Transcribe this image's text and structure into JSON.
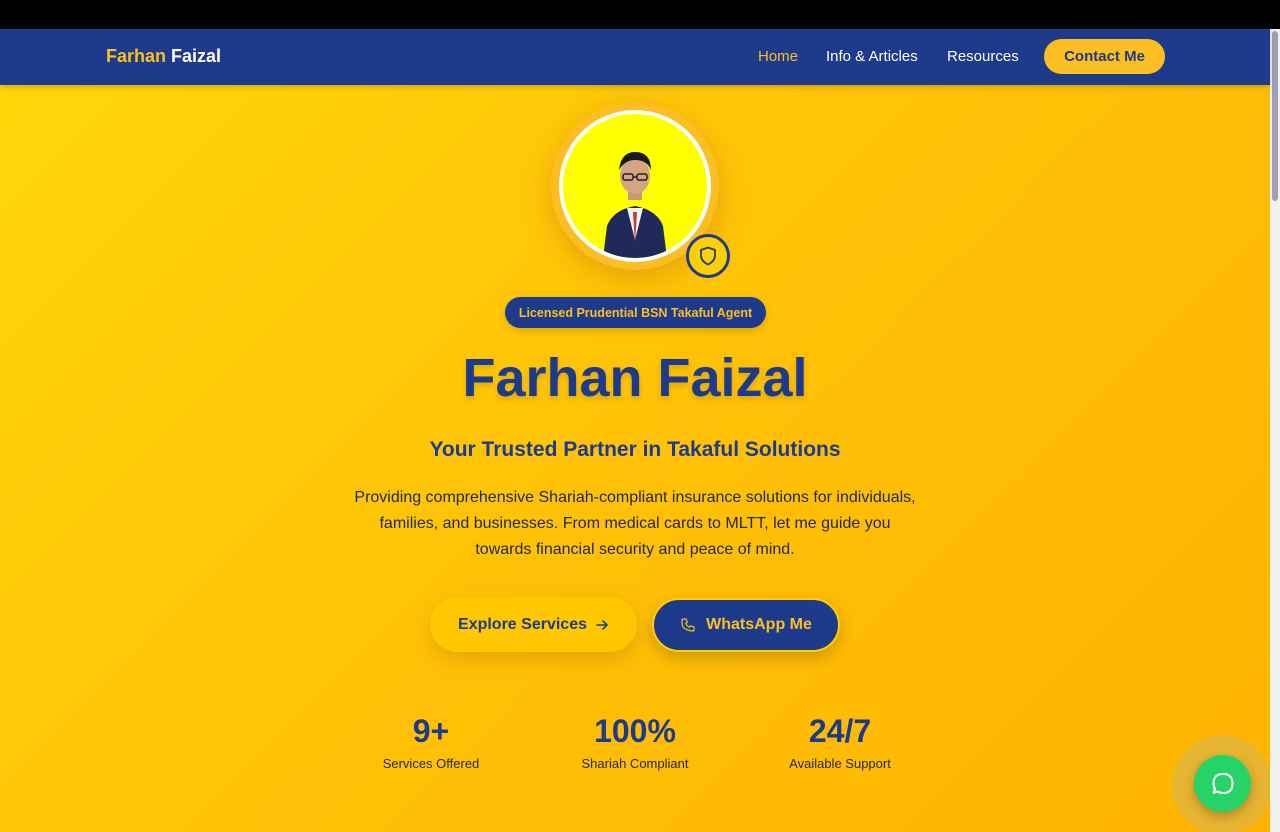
{
  "nav": {
    "brand_first": "Farhan",
    "brand_last": "Faizal",
    "links": [
      {
        "label": "Home",
        "active": true
      },
      {
        "label": "Info & Articles",
        "active": false
      },
      {
        "label": "Resources",
        "active": false
      }
    ],
    "contact_label": "Contact Me"
  },
  "hero": {
    "badge_icon": "shield-icon",
    "license_label": "Licensed Prudential BSN Takaful Agent",
    "name": "Farhan Faizal",
    "tagline": "Your Trusted Partner in Takaful Solutions",
    "description": "Providing comprehensive Shariah-compliant insurance solutions for individuals, families, and businesses. From medical cards to MLTT, let me guide you towards financial security and peace of mind.",
    "explore_label": "Explore Services",
    "explore_icon": "arrow-right-icon",
    "whatsapp_label": "WhatsApp Me",
    "whatsapp_icon": "phone-icon"
  },
  "stats": [
    {
      "value": "9+",
      "label": "Services Offered"
    },
    {
      "value": "100%",
      "label": "Shariah Compliant"
    },
    {
      "value": "24/7",
      "label": "Available Support"
    }
  ],
  "chat": {
    "icon": "chat-bubble-icon"
  },
  "colors": {
    "navy": "#1e3a8a",
    "gold": "#fbbf24",
    "hero_gradient_start": "#ffd60a",
    "hero_gradient_end": "#ffb300",
    "whatsapp_green": "#25d366"
  }
}
